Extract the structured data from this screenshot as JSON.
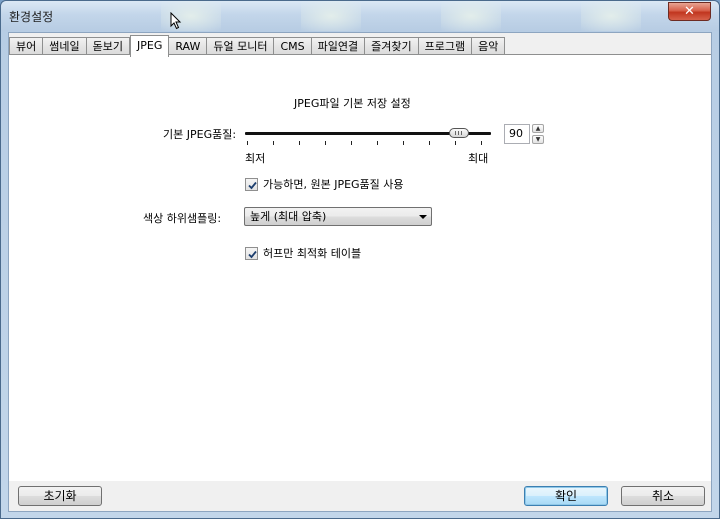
{
  "window": {
    "title": "환경설정",
    "close_symbol": "✕"
  },
  "tabs": [
    {
      "label": "뷰어",
      "active": false
    },
    {
      "label": "썸네일",
      "active": false
    },
    {
      "label": "돋보기",
      "active": false
    },
    {
      "label": "JPEG",
      "active": true
    },
    {
      "label": "RAW",
      "active": false
    },
    {
      "label": "듀얼 모니터",
      "active": false
    },
    {
      "label": "CMS",
      "active": false
    },
    {
      "label": "파일연결",
      "active": false
    },
    {
      "label": "즐겨찾기",
      "active": false
    },
    {
      "label": "프로그램",
      "active": false
    },
    {
      "label": "음악",
      "active": false
    }
  ],
  "jpeg": {
    "section_title": "JPEG파일 기본 저장 설정",
    "quality_label": "기본 JPEG품질:",
    "quality_min_label": "최저",
    "quality_max_label": "최대",
    "quality_value": "90",
    "quality_level": 0.9,
    "use_original_quality_label": "가능하면, 원본 JPEG품질 사용",
    "use_original_quality_checked": true,
    "subsampling_label": "색상 하위샘플링:",
    "subsampling_selected": "높게 (최대 압축)",
    "huffman_label": "허프만 최적화 테이블",
    "huffman_checked": true
  },
  "buttons": {
    "reset": "초기화",
    "ok": "확인",
    "cancel": "취소"
  },
  "icons": {
    "close": "close-icon",
    "checkmark": "checkmark-icon",
    "dropdown": "chevron-down-icon",
    "spin_up": "spin-up-icon",
    "spin_down": "spin-down-icon",
    "cursor": "mouse-cursor-icon"
  }
}
